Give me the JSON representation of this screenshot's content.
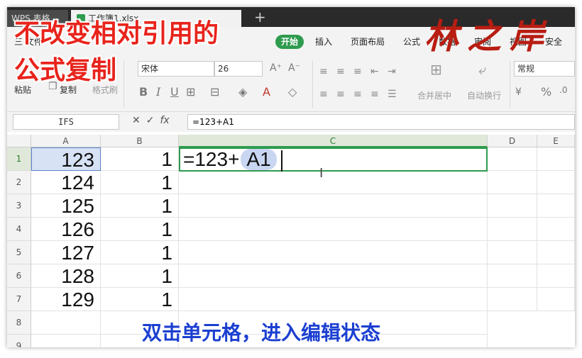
{
  "titlebar": {
    "tab_wps": "WPS 表格",
    "tab_book": "工作簿1.xlsx",
    "add_tab": "+"
  },
  "menu": {
    "file": "三 文件",
    "start": "开始",
    "insert": "插入",
    "page_layout": "页面布局",
    "formula": "公式",
    "data": "数据",
    "review": "审阅",
    "view": "视图",
    "security": "安全"
  },
  "toolbar": {
    "paste": "粘贴",
    "copy": "复制",
    "format_painter": "格式刷",
    "font_name": "宋体",
    "font_size": "26",
    "bold": "B",
    "italic": "I",
    "underline": "U",
    "merge_center": "合并居中",
    "auto_wrap": "自动换行",
    "number_format": "常规",
    "percent": "%"
  },
  "formula_bar": {
    "name_box": "IFS",
    "fx": "fx",
    "formula": "=123+A1"
  },
  "grid": {
    "columns": [
      "A",
      "B",
      "C",
      "D",
      "E"
    ],
    "rows": [
      "1",
      "2",
      "3",
      "4",
      "5",
      "6",
      "7",
      "8",
      "9"
    ],
    "col_a": [
      "123",
      "124",
      "125",
      "126",
      "127",
      "128",
      "129"
    ],
    "col_b": [
      "1",
      "1",
      "1",
      "1",
      "1",
      "1",
      "1"
    ],
    "edit_prefix": "=123+",
    "edit_ref": "A1"
  },
  "overlay": {
    "title_line1": "不改变相对引用的",
    "title_line2": "公式复制",
    "author": "林之岸",
    "caption": "双击单元格，进入编辑状态"
  },
  "colors": {
    "accent_green": "#2e9b4e",
    "title_red": "#e8241c",
    "caption_blue": "#1b3fd1",
    "ref_highlight": "#c9d6f1"
  }
}
